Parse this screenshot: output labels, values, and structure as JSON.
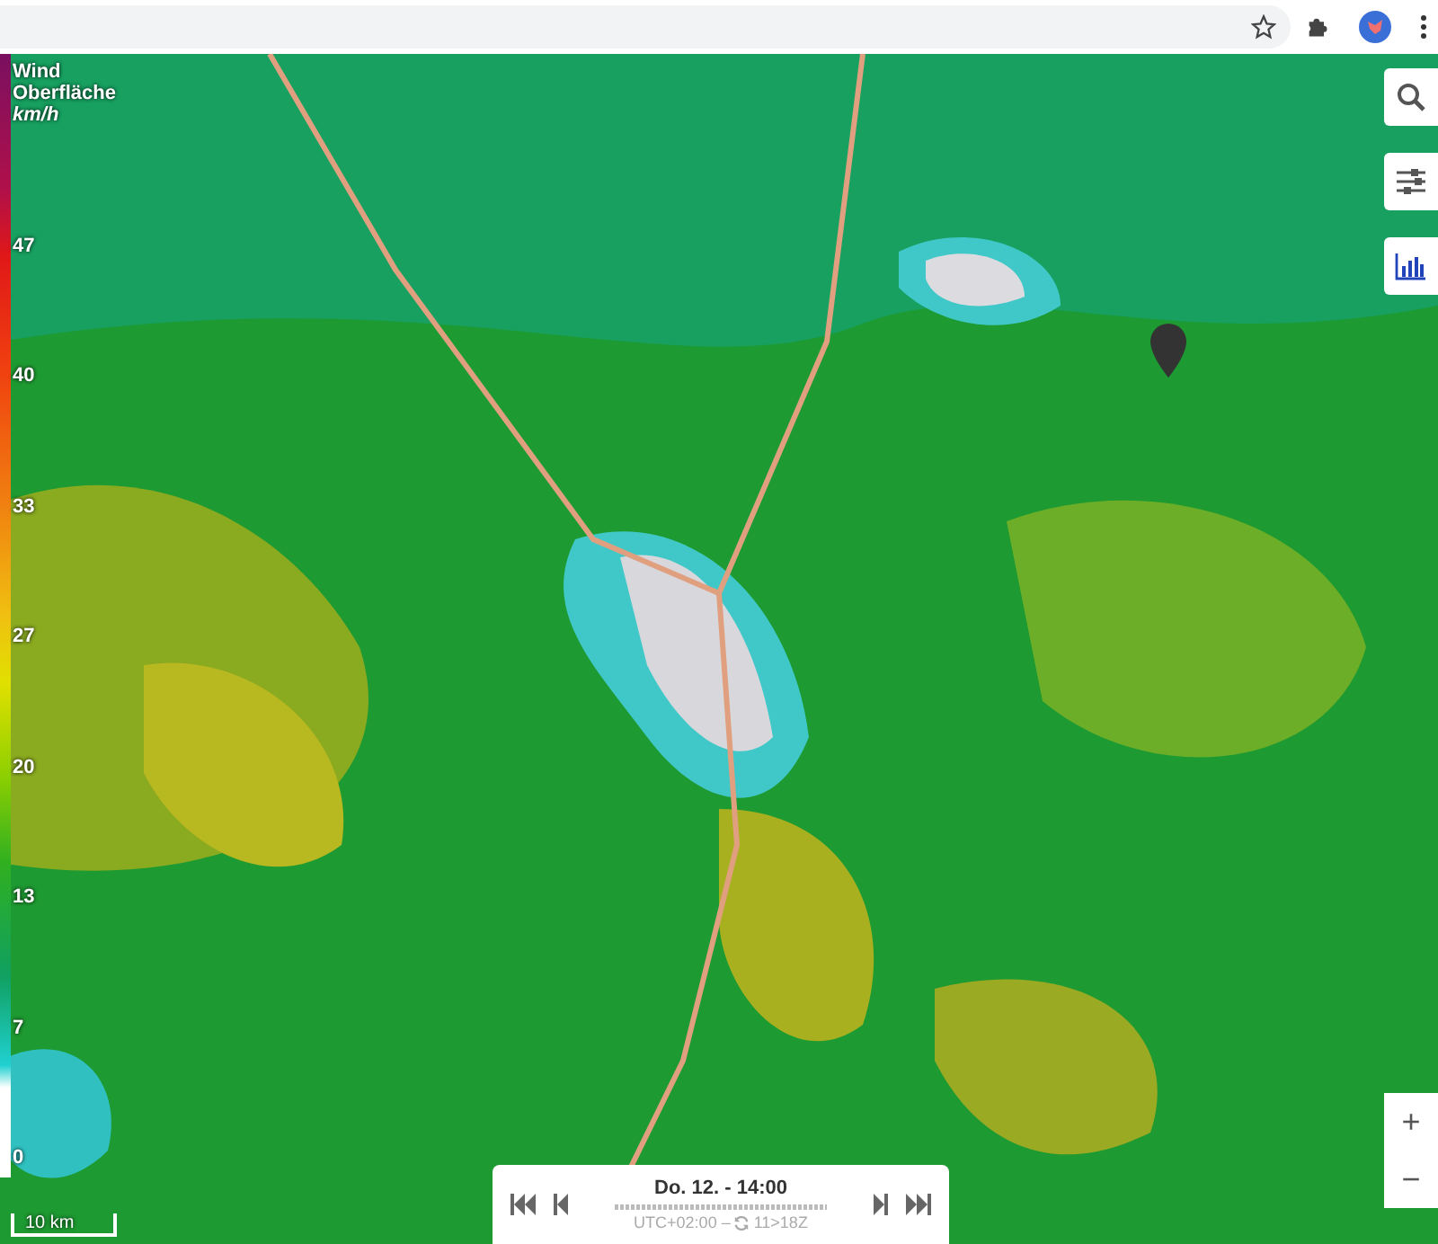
{
  "legend": {
    "title": "Wind",
    "subtitle": "Oberfläche",
    "unit": "km/h",
    "ticks": [
      "47",
      "40",
      "33",
      "27",
      "20",
      "13",
      "7",
      "0"
    ]
  },
  "scale": {
    "label": "10 km"
  },
  "time_panel": {
    "date": "Do. 12. - 14:00",
    "timezone": "UTC+02:00 –",
    "run": "11>18Z"
  },
  "zoom": {
    "in": "+",
    "out": "−"
  }
}
